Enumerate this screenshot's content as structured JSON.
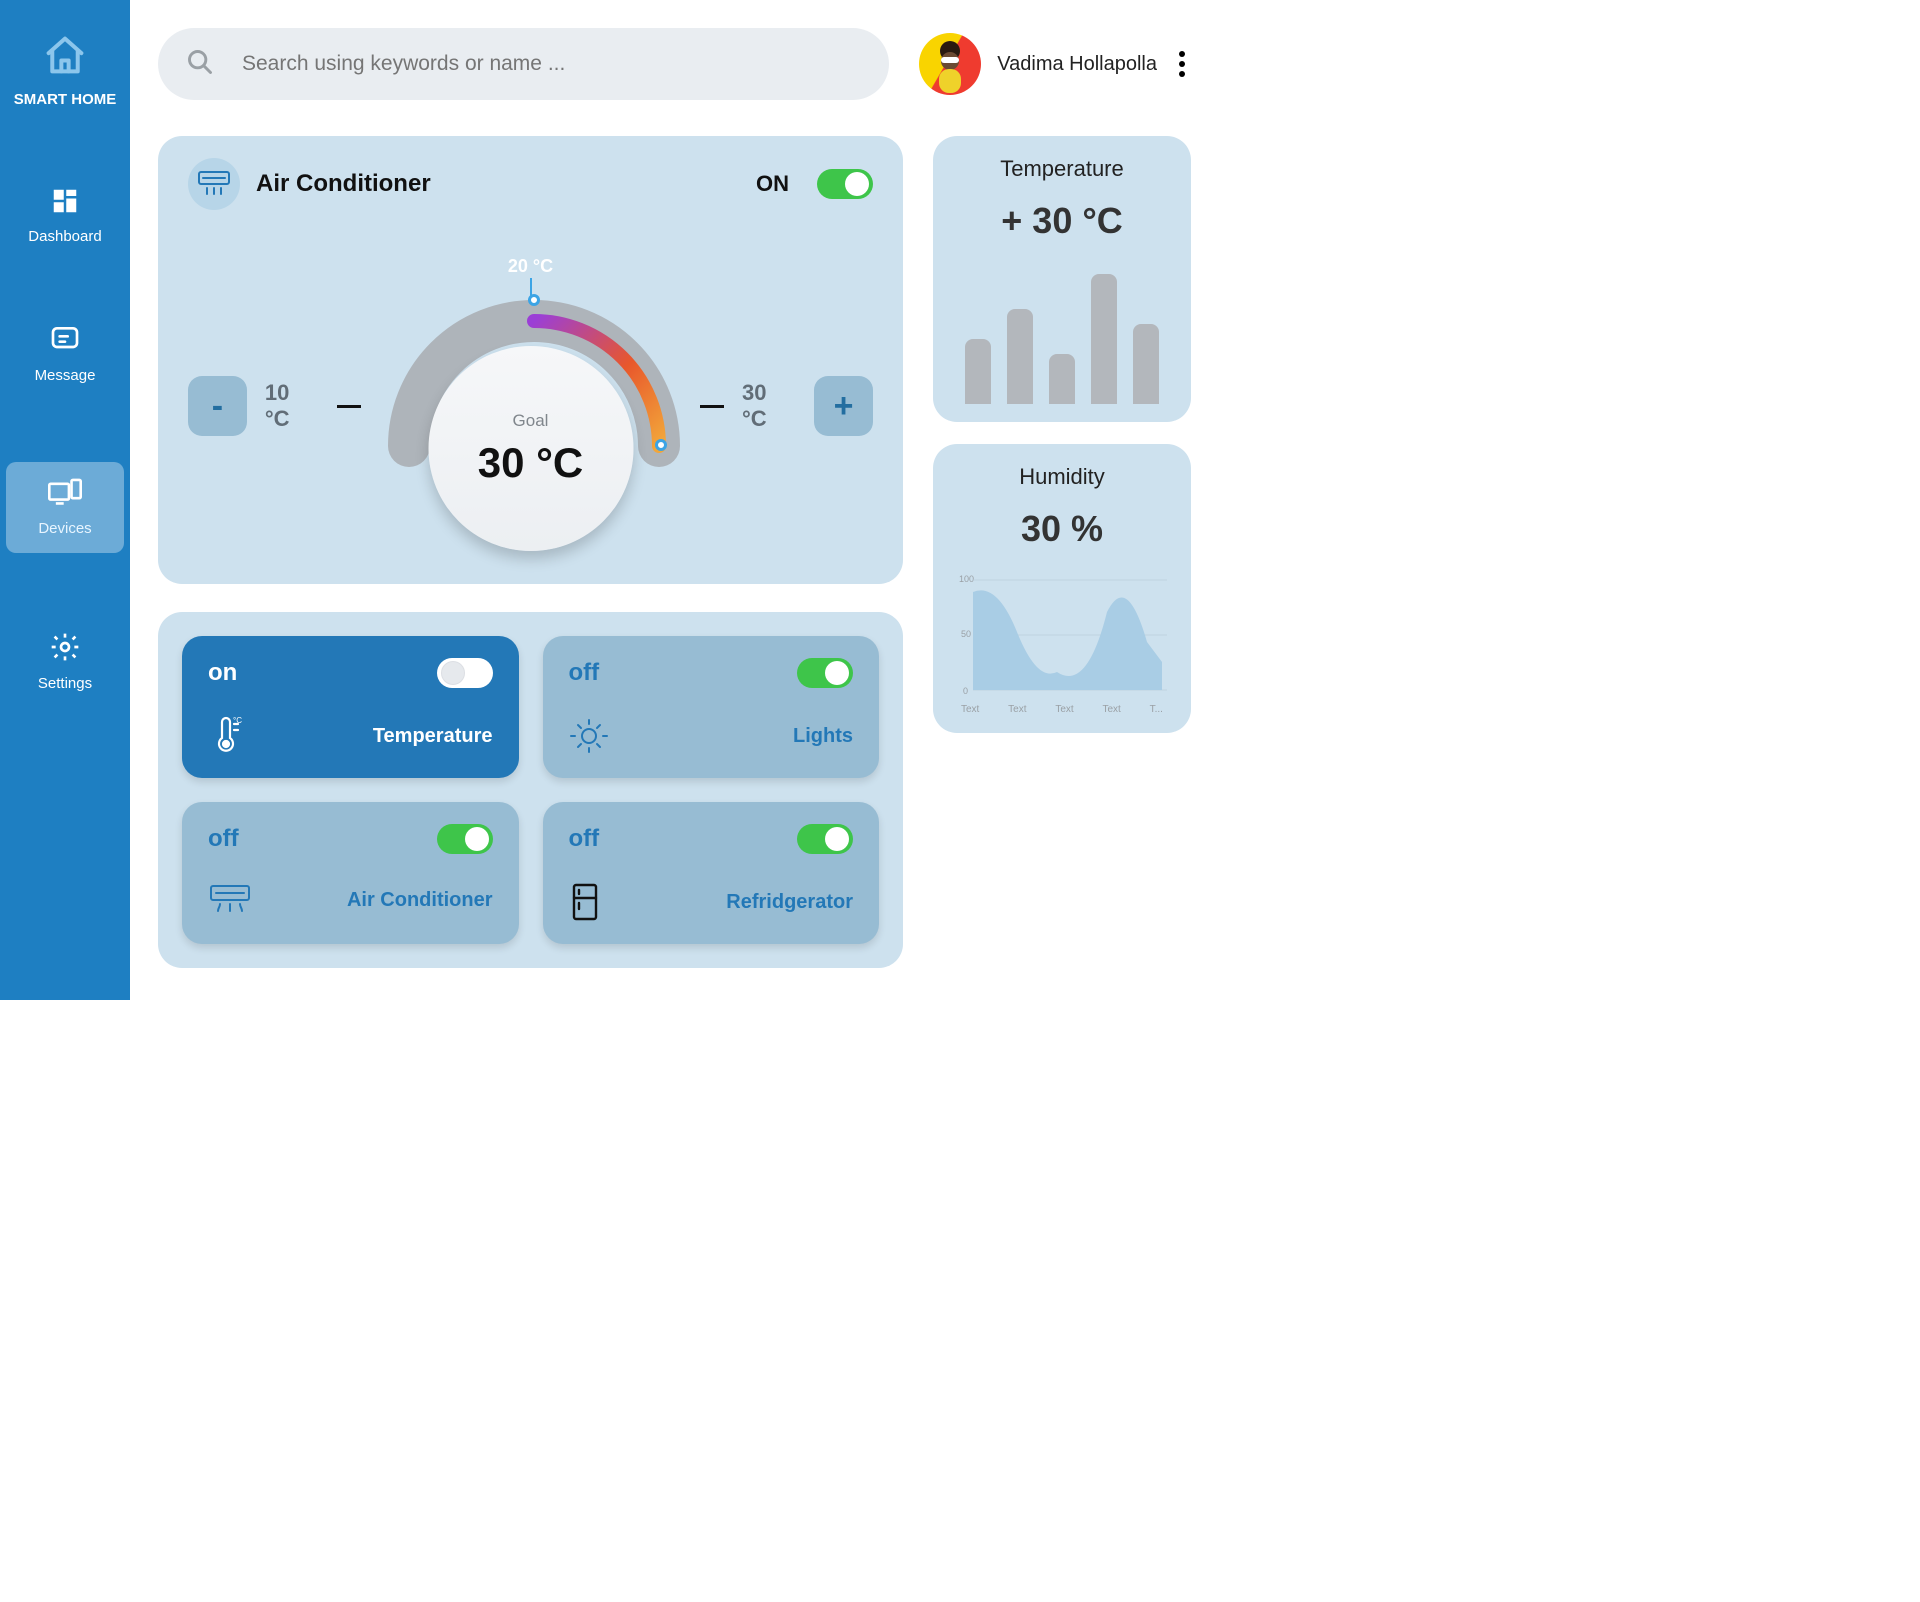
{
  "sidebar": {
    "brand": "SMART HOME",
    "items": [
      {
        "label": "Dashboard",
        "icon": "grid-icon"
      },
      {
        "label": "Message",
        "icon": "message-icon"
      },
      {
        "label": "Devices",
        "icon": "devices-icon"
      },
      {
        "label": "Settings",
        "icon": "gear-icon"
      }
    ],
    "active_index": 2
  },
  "search": {
    "placeholder": "Search using keywords or name ..."
  },
  "user": {
    "name": "Vadima Hollapolla"
  },
  "ac": {
    "title": "Air Conditioner",
    "status_label": "ON",
    "toggle_on": true,
    "range_top": "20 °C",
    "range_left": "10 °C",
    "range_right": "30 °C",
    "goal_label": "Goal",
    "goal_value": "30 °C"
  },
  "devices": [
    {
      "state": "on",
      "label": "Temperature",
      "icon": "thermo-icon",
      "toggle": "white"
    },
    {
      "state": "off",
      "label": "Lights",
      "icon": "light-icon",
      "toggle": "green"
    },
    {
      "state": "off",
      "label": "Air Conditioner",
      "icon": "ac-icon",
      "toggle": "green"
    },
    {
      "state": "off",
      "label": "Refridgerator",
      "icon": "fridge-icon",
      "toggle": "green"
    }
  ],
  "temperature": {
    "title": "Temperature",
    "value": "+ 30 °C"
  },
  "humidity": {
    "title": "Humidity",
    "value": "30 %",
    "axis_y": [
      "100",
      "50",
      "0"
    ],
    "axis_x": [
      "Text",
      "Text",
      "Text",
      "Text",
      "T..."
    ]
  },
  "chart_data": [
    {
      "type": "bar",
      "title": "Temperature",
      "values": [
        65,
        95,
        50,
        130,
        80
      ],
      "ylim": [
        0,
        140
      ]
    },
    {
      "type": "area",
      "title": "Humidity",
      "categories": [
        "Text",
        "Text",
        "Text",
        "Text",
        "T..."
      ],
      "values": [
        90,
        40,
        20,
        90,
        30
      ],
      "ylim": [
        0,
        100
      ]
    }
  ],
  "colors": {
    "accent": "#1e7fc2",
    "card": "#cde1ee",
    "green": "#3ec54a"
  }
}
